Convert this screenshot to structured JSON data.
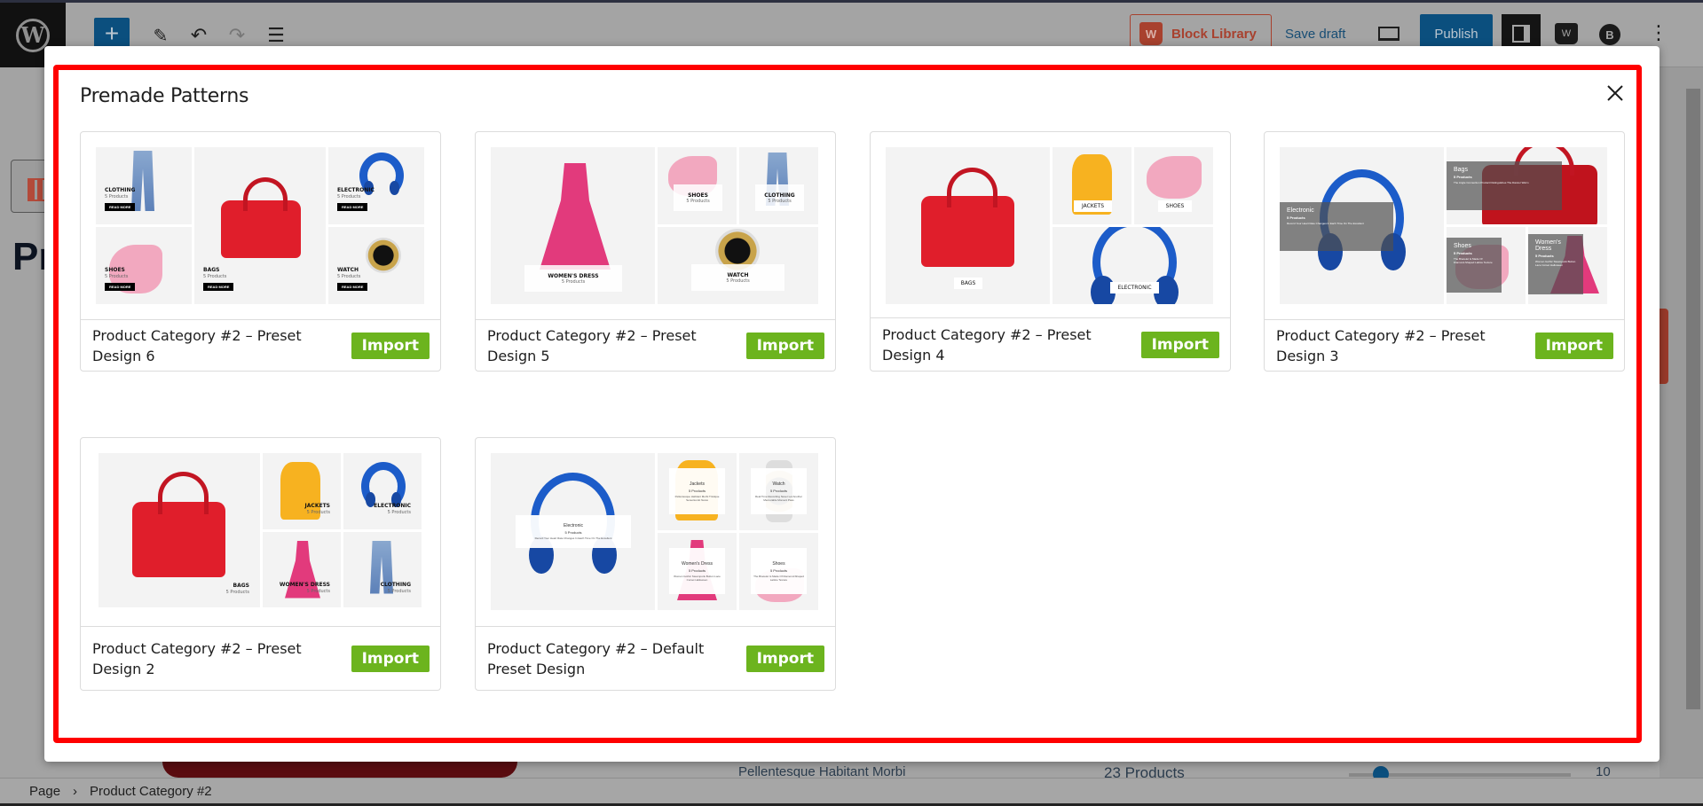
{
  "editor": {
    "toolbar": {
      "add_block": "+",
      "block_library_label": "Block Library",
      "save_draft_label": "Save draft",
      "publish_label": "Publish"
    },
    "background_title_partial": "Pr",
    "background_row_text": "Pellentesque Habitant Morbi",
    "background_products": "23 Products",
    "background_number": "10",
    "breadcrumb": [
      "Page",
      "Product Category #2"
    ],
    "breadcrumb_separator": "›"
  },
  "modal": {
    "title": "Premade Patterns",
    "close_label": "×",
    "patterns": [
      {
        "name": "Product Category #2 – Preset Design 6",
        "import_label": "Import",
        "tiles": [
          {
            "title": "CLOTHING",
            "count": "5 Products",
            "button": "READ MORE"
          },
          {
            "title": "BAGS",
            "count": "5 Products",
            "button": "READ MORE"
          },
          {
            "title": "ELECTRONIC",
            "count": "5 Products",
            "button": "READ MORE"
          },
          {
            "title": "SHOES",
            "count": "5 Products",
            "button": "READ MORE"
          },
          {
            "title": "WATCH",
            "count": "5 Products",
            "button": "READ MORE"
          }
        ]
      },
      {
        "name": "Product Category #2 – Preset Design 5",
        "import_label": "Import",
        "tiles": [
          {
            "title": "WOMEN'S DRESS",
            "count": "5 Products"
          },
          {
            "title": "SHOES",
            "count": "5 Products"
          },
          {
            "title": "CLOTHING",
            "count": "5 Products"
          },
          {
            "title": "WATCH",
            "count": "5 Products"
          }
        ]
      },
      {
        "name": "Product Category #2 – Preset Design 4",
        "import_label": "Import",
        "tiles": [
          {
            "title": "BAGS"
          },
          {
            "title": "JACKETS"
          },
          {
            "title": "SHOES"
          },
          {
            "title": "ELECTRONIC"
          }
        ]
      },
      {
        "name": "Product Category #2 – Preset Design 3",
        "import_label": "Import",
        "tiles": [
          {
            "title": "Electronic",
            "count": "5 Products",
            "desc": "Record Your Heart Rate Changes In Each Time On The Excellent"
          },
          {
            "title": "Bags",
            "count": "5 Products",
            "desc": "The Angle Connection Product Distinguishes The Dancer Warm"
          },
          {
            "title": "Shoes",
            "count": "5 Products",
            "desc": "The Bracelet Is Made Of Diamond-Shaped Lattice Texture"
          },
          {
            "title": "Women's Dress",
            "count": "5 Products",
            "desc": "Women Gothic Steampunk Button Lace Corset Halloween"
          }
        ]
      },
      {
        "name": "Product Category #2 – Preset Design 2",
        "import_label": "Import",
        "tiles": [
          {
            "title": "BAGS",
            "count": "5 Products"
          },
          {
            "title": "JACKETS",
            "count": "5 Products"
          },
          {
            "title": "ELECTRONIC",
            "count": "5 Products"
          },
          {
            "title": "WOMEN'S DRESS",
            "count": "5 Products"
          },
          {
            "title": "CLOTHING",
            "count": "5 Products"
          }
        ]
      },
      {
        "name": "Product Category #2 – Default Preset Design",
        "import_label": "Import",
        "tiles": [
          {
            "title": "Electronic",
            "count": "5 Products",
            "desc": "Record Your Heart Rate Changes In Each Time On The Excellent"
          },
          {
            "title": "Jackets",
            "count": "5 Products",
            "desc": "Pellentesque Habitant Morbi Tristique Senectus Et Netus"
          },
          {
            "title": "Watch",
            "count": "5 Products",
            "desc": "Real Time Recording Never Let Another Memorable Moment Pass"
          },
          {
            "title": "Women's Dress",
            "count": "5 Products",
            "desc": "Women Gothic Steampunk Button Lace Corset Halloween"
          },
          {
            "title": "Shoes",
            "count": "5 Products",
            "desc": "The Bracelet Is Made Of Diamond-Shaped Lattice Texture"
          }
        ]
      }
    ]
  },
  "colors": {
    "import_button": "#6cb41e",
    "highlight_border": "#ff0000",
    "publish": "#0b4f7e",
    "block_library": "#a8412e"
  }
}
